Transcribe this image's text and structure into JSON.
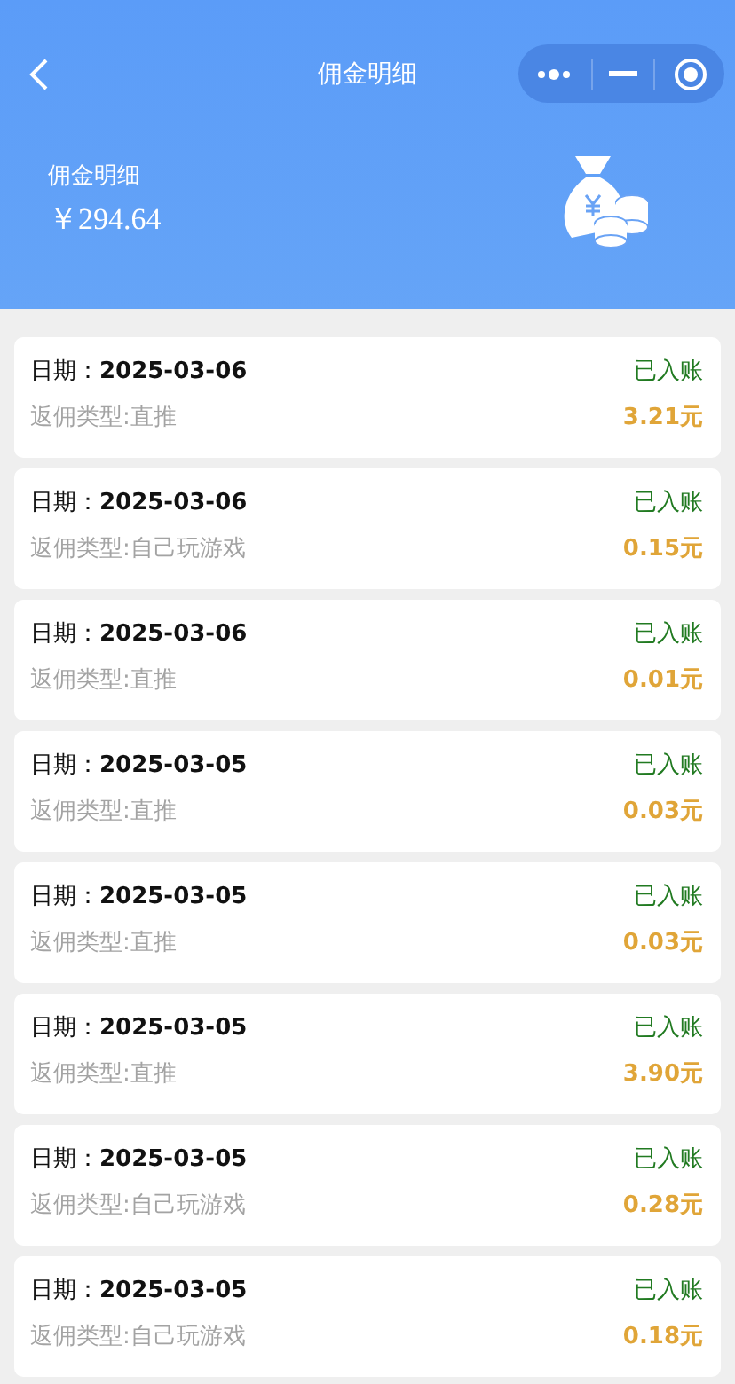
{
  "nav": {
    "title": "佣金明细"
  },
  "summary": {
    "label": "佣金明细",
    "amount": "￥294.64"
  },
  "records": [
    {
      "date": "日期：**2025-03-06**",
      "type": "返佣类型:直推",
      "status": "已入账",
      "amount": "3.21元"
    },
    {
      "date": "日期：**2025-03-06**",
      "type": "返佣类型:自己玩游戏",
      "status": "已入账",
      "amount": "0.15元"
    },
    {
      "date": "日期：**2025-03-06**",
      "type": "返佣类型:直推",
      "status": "已入账",
      "amount": "0.01元"
    },
    {
      "date": "日期：**2025-03-05**",
      "type": "返佣类型:直推",
      "status": "已入账",
      "amount": "0.03元"
    },
    {
      "date": "日期：**2025-03-05**",
      "type": "返佣类型:直推",
      "status": "已入账",
      "amount": "0.03元"
    },
    {
      "date": "日期：**2025-03-05**",
      "type": "返佣类型:直推",
      "status": "已入账",
      "amount": "3.90元"
    },
    {
      "date": "日期：**2025-03-05**",
      "type": "返佣类型:自己玩游戏",
      "status": "已入账",
      "amount": "0.28元"
    },
    {
      "date": "日期：**2025-03-05**",
      "type": "返佣类型:自己玩游戏",
      "status": "已入账",
      "amount": "0.18元"
    }
  ]
}
